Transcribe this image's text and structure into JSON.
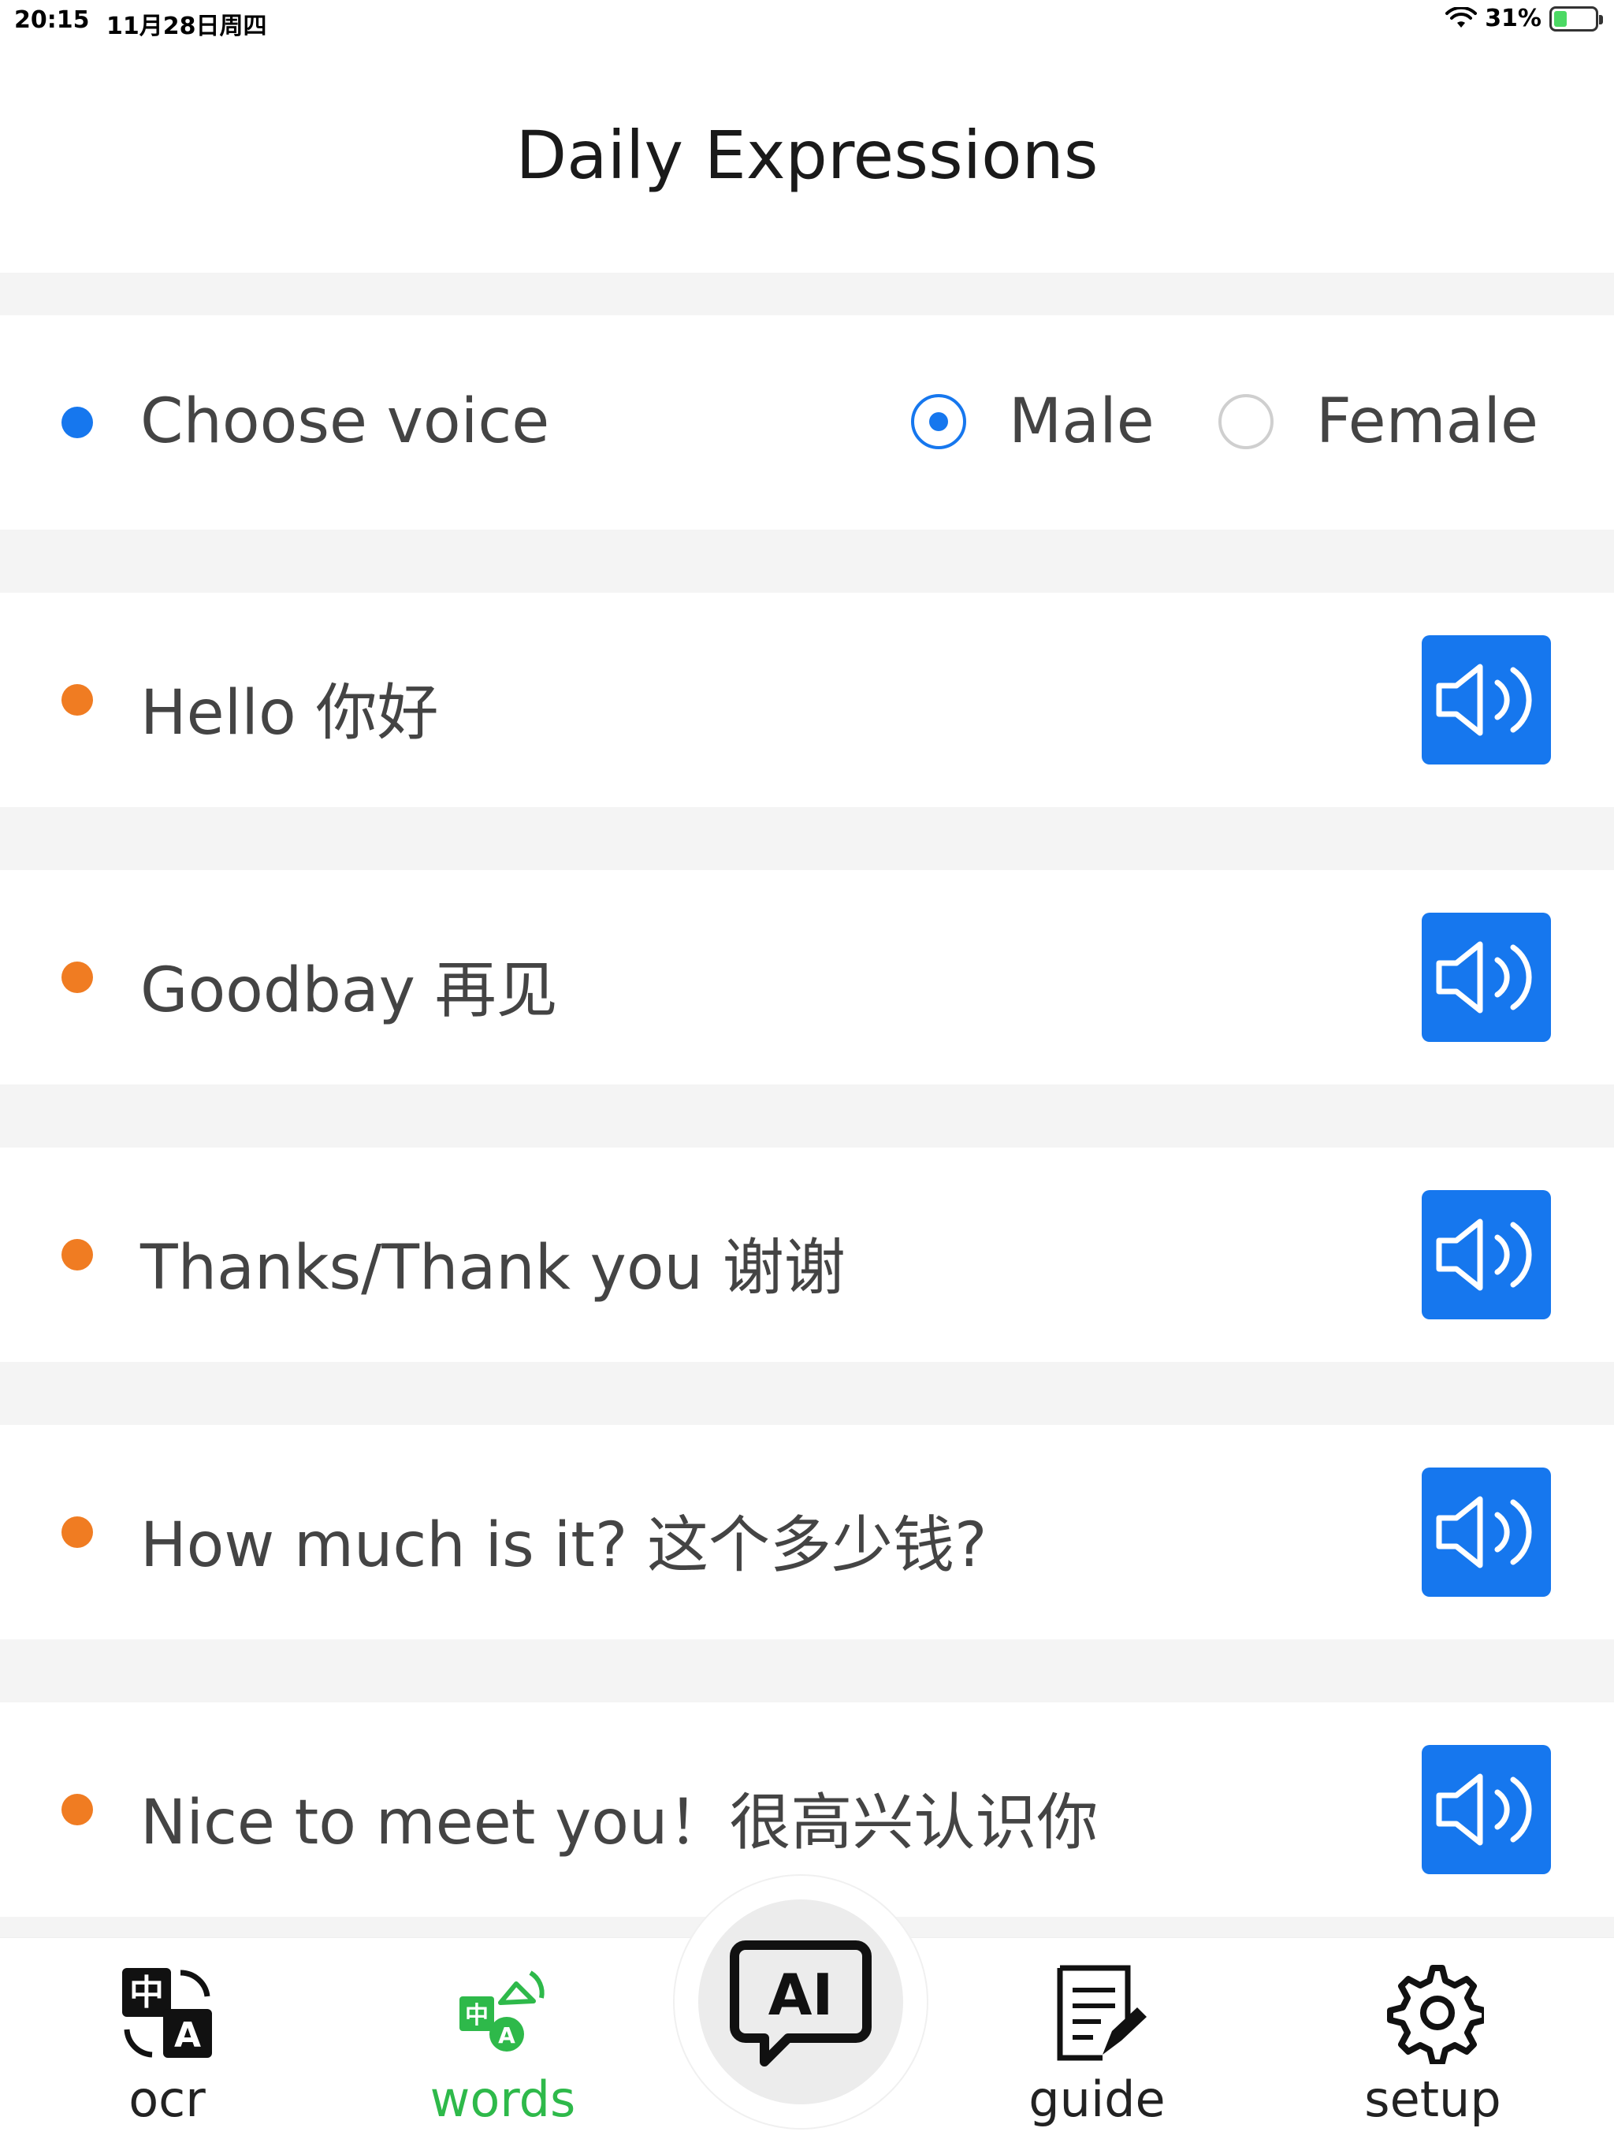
{
  "status_bar": {
    "time": "20:15",
    "date": "11月28日周四",
    "battery_percent": "31%",
    "battery_level": 0.31
  },
  "header": {
    "title": "Daily Expressions"
  },
  "voice": {
    "label": "Choose voice",
    "options": [
      "Male",
      "Female"
    ],
    "selected": "Male"
  },
  "expressions": [
    {
      "text": "Hello 你好"
    },
    {
      "text": "Goodbay 再见"
    },
    {
      "text": "Thanks/Thank you 谢谢"
    },
    {
      "text": "How much is it? 这个多少钱?"
    },
    {
      "text": "Nice to meet you！很高兴认识你"
    }
  ],
  "nav": {
    "items": [
      {
        "label": "ocr",
        "icon": "ocr-translate-icon"
      },
      {
        "label": "words",
        "icon": "words-speaker-icon",
        "active": true
      },
      {
        "label": "",
        "icon": "ai-chat-icon"
      },
      {
        "label": "guide",
        "icon": "guide-document-icon"
      },
      {
        "label": "setup",
        "icon": "gear-icon"
      }
    ],
    "ai_icon_text": "AI",
    "ocr_icon_text_1": "中",
    "ocr_icon_text_2": "A"
  },
  "colors": {
    "accent_blue": "#1677ee",
    "bullet_orange": "#f07c22",
    "active_green": "#2eb94a"
  }
}
